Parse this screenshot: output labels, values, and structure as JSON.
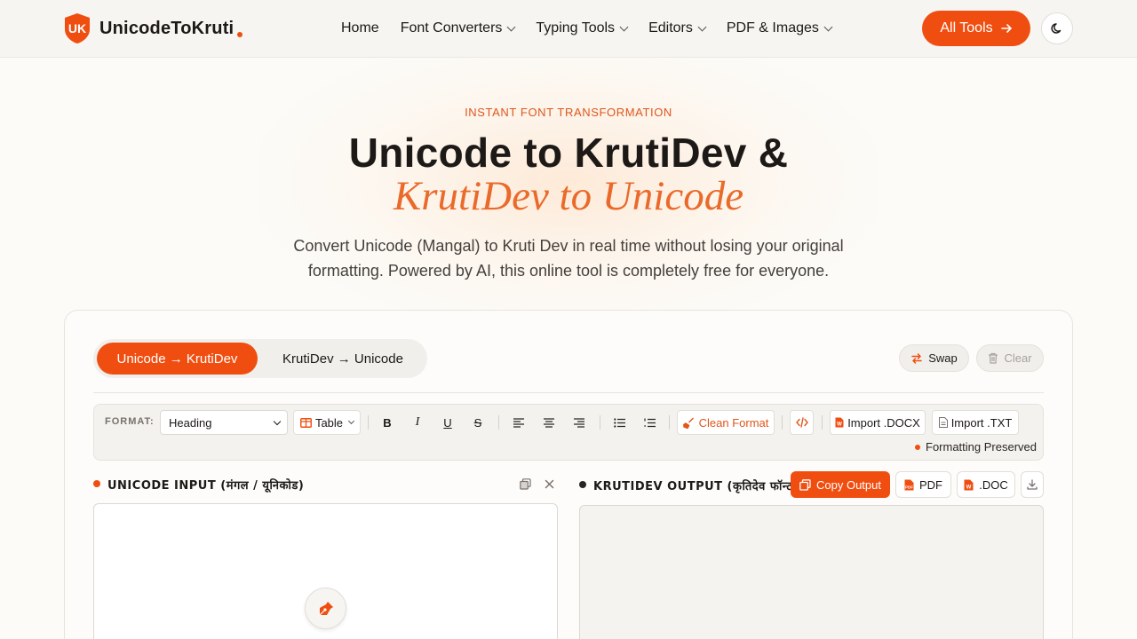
{
  "brand": {
    "name": "UnicodeToKruti",
    "logo_letters": "UK"
  },
  "nav": {
    "items": [
      {
        "label": "Home",
        "dropdown": false
      },
      {
        "label": "Font Converters",
        "dropdown": true
      },
      {
        "label": "Typing Tools",
        "dropdown": true
      },
      {
        "label": "Editors",
        "dropdown": true
      },
      {
        "label": "PDF & Images",
        "dropdown": true
      }
    ],
    "cta_label": "All Tools",
    "theme_icon": "moon-icon"
  },
  "hero": {
    "eyebrow": "INSTANT FONT TRANSFORMATION",
    "title_line1": "Unicode to KrutiDev &",
    "title_line2": "KrutiDev to Unicode",
    "subtitle": "Convert Unicode (Mangal) to Kruti Dev in real time without losing your original formatting. Powered by AI, this online tool is completely free for everyone."
  },
  "converter": {
    "modes": [
      {
        "label": "Unicode → KrutiDev",
        "active": true
      },
      {
        "label": "KrutiDev → Unicode",
        "active": false
      }
    ],
    "swap_label": "Swap",
    "clear_label": "Clear",
    "toolbar": {
      "format_label": "FORMAT:",
      "format_value": "Heading",
      "table_label": "Table",
      "clean_format_label": "Clean Format",
      "import_docx_label": "Import .DOCX",
      "import_txt_label": "Import .TXT",
      "status": "Formatting Preserved"
    },
    "input_panel": {
      "title": "UNICODE INPUT (मंगल / यूनिकोड)"
    },
    "output_panel": {
      "title": "KRUTIDEV OUTPUT (कृतिदेव फॉन्ट)",
      "copy_label": "Copy Output",
      "pdf_label": "PDF",
      "doc_label": ".DOC"
    }
  },
  "colors": {
    "accent": "#f04e10",
    "accent_italic": "#ea6a2a",
    "background": "#fcfbf8"
  }
}
